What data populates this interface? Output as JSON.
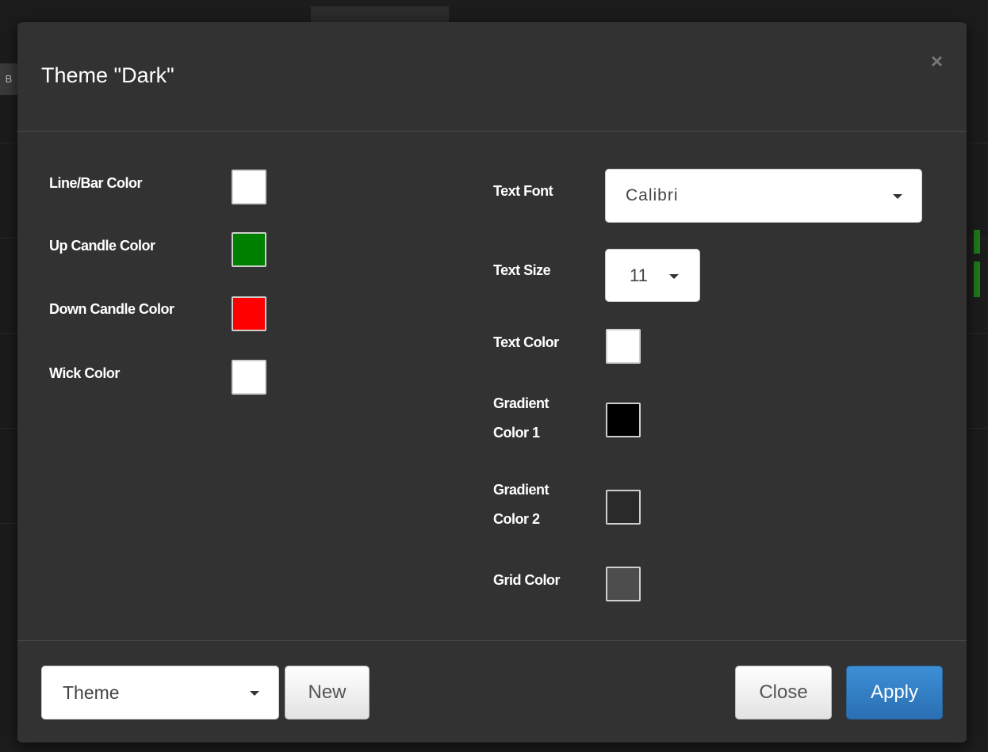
{
  "dialog": {
    "title": "Theme \"Dark\"",
    "close_icon": "×"
  },
  "background": {
    "tab_letter": "B"
  },
  "left_settings": [
    {
      "label": "Line/Bar Color",
      "color": "#ffffff"
    },
    {
      "label": "Up Candle Color",
      "color": "#008000"
    },
    {
      "label": "Down Candle Color",
      "color": "#ff0000"
    },
    {
      "label": "Wick Color",
      "color": "#ffffff"
    }
  ],
  "right_settings": {
    "text_font": {
      "label": "Text Font",
      "value": "Calibri"
    },
    "text_size": {
      "label": "Text Size",
      "value": "11"
    },
    "text_color": {
      "label": "Text Color",
      "color": "#ffffff"
    },
    "gradient_color_1": {
      "label_line1": "Gradient",
      "label_line2": "Color 1",
      "color": "#000000"
    },
    "gradient_color_2": {
      "label_line1": "Gradient",
      "label_line2": "Color 2",
      "color": "#2a2a2a"
    },
    "grid_color": {
      "label": "Grid Color",
      "color": "#4d4d4d"
    }
  },
  "footer": {
    "theme_select": "Theme",
    "new_button": "New",
    "close_button": "Close",
    "apply_button": "Apply"
  },
  "icons": {
    "close": "close-icon",
    "dropdown": "caret-down-icon"
  }
}
